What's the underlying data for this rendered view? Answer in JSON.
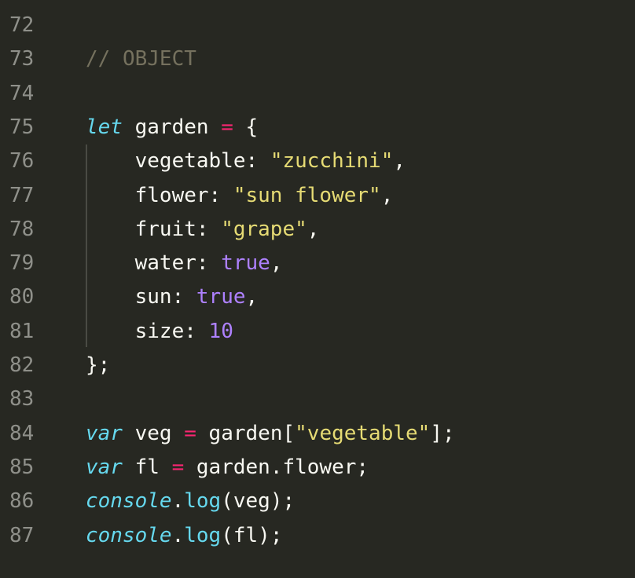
{
  "editor": {
    "theme_colors": {
      "background": "#272822",
      "gutter_text": "#8f908a",
      "comment": "#75715e",
      "keyword": "#66d9ef",
      "operator": "#f92672",
      "string": "#e6db74",
      "constant": "#ae81ff",
      "text": "#f8f8f2"
    },
    "lines": [
      {
        "number": "72",
        "tokens": []
      },
      {
        "number": "73",
        "tokens": [
          {
            "t": "comment",
            "v": "// OBJECT"
          }
        ]
      },
      {
        "number": "74",
        "tokens": []
      },
      {
        "number": "75",
        "tokens": [
          {
            "t": "keyword",
            "v": "let"
          },
          {
            "t": "plain",
            "v": " garden "
          },
          {
            "t": "op",
            "v": "="
          },
          {
            "t": "plain",
            "v": " {"
          }
        ]
      },
      {
        "number": "76",
        "tokens": [
          {
            "t": "plain",
            "v": "    vegetable: "
          },
          {
            "t": "str",
            "v": "\"zucchini\""
          },
          {
            "t": "plain",
            "v": ","
          }
        ]
      },
      {
        "number": "77",
        "tokens": [
          {
            "t": "plain",
            "v": "    flower: "
          },
          {
            "t": "str",
            "v": "\"sun flower\""
          },
          {
            "t": "plain",
            "v": ","
          }
        ]
      },
      {
        "number": "78",
        "tokens": [
          {
            "t": "plain",
            "v": "    fruit: "
          },
          {
            "t": "str",
            "v": "\"grape\""
          },
          {
            "t": "plain",
            "v": ","
          }
        ]
      },
      {
        "number": "79",
        "tokens": [
          {
            "t": "plain",
            "v": "    water: "
          },
          {
            "t": "bool",
            "v": "true"
          },
          {
            "t": "plain",
            "v": ","
          }
        ]
      },
      {
        "number": "80",
        "tokens": [
          {
            "t": "plain",
            "v": "    sun: "
          },
          {
            "t": "bool",
            "v": "true"
          },
          {
            "t": "plain",
            "v": ","
          }
        ]
      },
      {
        "number": "81",
        "tokens": [
          {
            "t": "plain",
            "v": "    size: "
          },
          {
            "t": "num",
            "v": "10"
          }
        ]
      },
      {
        "number": "82",
        "tokens": [
          {
            "t": "plain",
            "v": "};"
          }
        ]
      },
      {
        "number": "83",
        "tokens": []
      },
      {
        "number": "84",
        "tokens": [
          {
            "t": "keyword",
            "v": "var"
          },
          {
            "t": "plain",
            "v": " veg "
          },
          {
            "t": "op",
            "v": "="
          },
          {
            "t": "plain",
            "v": " garden["
          },
          {
            "t": "str",
            "v": "\"vegetable\""
          },
          {
            "t": "plain",
            "v": "];"
          }
        ]
      },
      {
        "number": "85",
        "tokens": [
          {
            "t": "keyword",
            "v": "var"
          },
          {
            "t": "plain",
            "v": " fl "
          },
          {
            "t": "op",
            "v": "="
          },
          {
            "t": "plain",
            "v": " garden.flower;"
          }
        ]
      },
      {
        "number": "86",
        "tokens": [
          {
            "t": "builtin",
            "v": "console"
          },
          {
            "t": "plain",
            "v": "."
          },
          {
            "t": "method",
            "v": "log"
          },
          {
            "t": "plain",
            "v": "(veg);"
          }
        ]
      },
      {
        "number": "87",
        "tokens": [
          {
            "t": "builtin",
            "v": "console"
          },
          {
            "t": "plain",
            "v": "."
          },
          {
            "t": "method",
            "v": "log"
          },
          {
            "t": "plain",
            "v": "(fl);"
          }
        ]
      }
    ]
  }
}
